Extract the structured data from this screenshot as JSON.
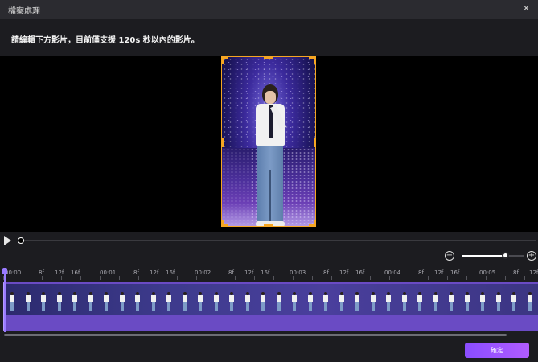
{
  "window": {
    "title": "檔案處理"
  },
  "instruction": "請編輯下方影片，目前僅支援 120s 秒以內的影片。",
  "preview": {
    "player_progress": 0
  },
  "zoom": {
    "level": 0.72,
    "minus_icon": "zoom-out-icon",
    "plus_icon": "zoom-in-icon"
  },
  "timeline": {
    "ruler_labels": [
      "00:00",
      "8f",
      "12f",
      "16f",
      "00:01",
      "8f",
      "12f",
      "16f",
      "00:02",
      "8f",
      "12f",
      "16f",
      "00:03",
      "8f",
      "12f",
      "16f",
      "00:04",
      "8f",
      "12f",
      "16f",
      "00:05",
      "8f",
      "12f"
    ]
  },
  "actions": {
    "confirm_label": "確定"
  },
  "colors": {
    "accent": "#9a5cff",
    "crop_frame": "#f5a623",
    "track": "#6a4bc4"
  }
}
